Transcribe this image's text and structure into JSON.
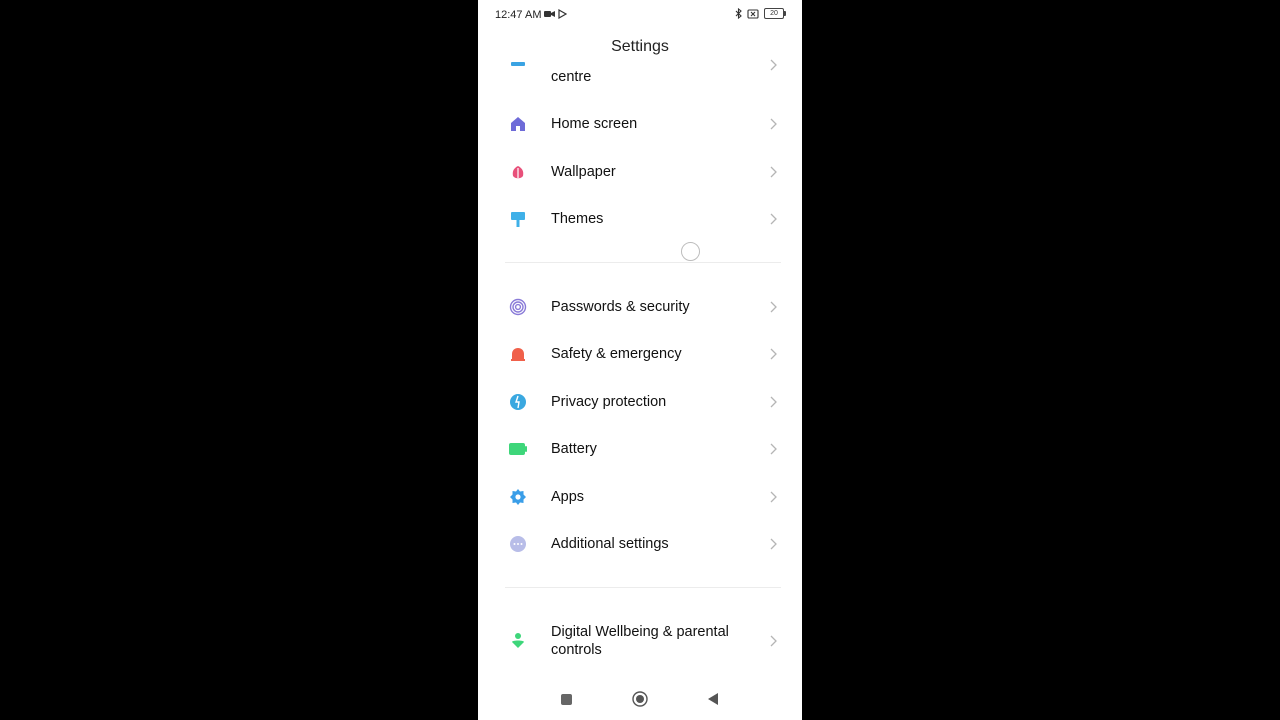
{
  "status_bar": {
    "time": "12:47 AM",
    "battery": "20"
  },
  "header": {
    "title": "Settings"
  },
  "settings": {
    "items": [
      {
        "label": "centre",
        "icon": "control-centre-icon",
        "color": "#3aa3e3"
      },
      {
        "label": "Home screen",
        "icon": "home-icon",
        "color": "#6e6bd8"
      },
      {
        "label": "Wallpaper",
        "icon": "wallpaper-icon",
        "color": "#e8507a"
      },
      {
        "label": "Themes",
        "icon": "themes-icon",
        "color": "#3fb0e8"
      },
      {
        "label": "Passwords & security",
        "icon": "fingerprint-icon",
        "color": "#8a7bd8"
      },
      {
        "label": "Safety & emergency",
        "icon": "emergency-icon",
        "color": "#f0604a"
      },
      {
        "label": "Privacy protection",
        "icon": "privacy-icon",
        "color": "#3aa8e0"
      },
      {
        "label": "Battery",
        "icon": "battery-icon",
        "color": "#3ed67a"
      },
      {
        "label": "Apps",
        "icon": "apps-gear-icon",
        "color": "#3a9ee8"
      },
      {
        "label": "Additional settings",
        "icon": "more-icon",
        "color": "#b8bde8"
      },
      {
        "label": "Digital Wellbeing & parental controls",
        "icon": "wellbeing-icon",
        "color": "#3ed67a"
      }
    ]
  }
}
